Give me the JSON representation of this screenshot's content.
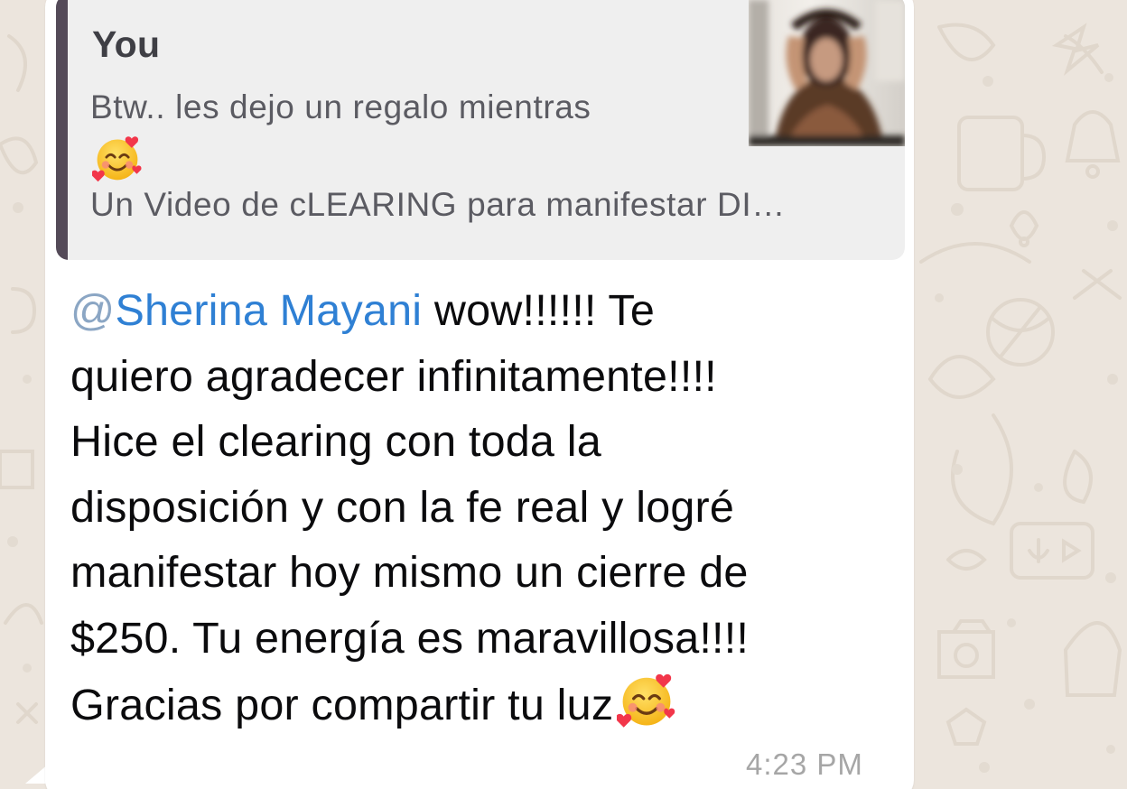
{
  "quoted_message": {
    "author": "You",
    "line1": "Btw.. les dejo un regalo mientras",
    "emoji": "smiling-face-with-hearts",
    "line2": "Un Video de cLEARING para manifestar DI…",
    "thumbnail": "video-thumbnail"
  },
  "message": {
    "mention_at": "@",
    "mention_name": "Sherina Mayani",
    "line1_rest": " wow!!!!!! Te",
    "line2": "quiero agradecer infinitamente!!!!",
    "line3": "Hice el clearing con toda la",
    "line4": "disposición y con la fe real y logré",
    "line5": "manifestar hoy mismo un cierre de",
    "line6": "$250. Tu energía es maravillosa!!!!",
    "line7": "Gracias por compartir tu luz",
    "emoji": "smiling-face-with-hearts",
    "time": "4:23 PM"
  },
  "colors": {
    "wallpaper": "#ece5dd",
    "bubble": "#ffffff",
    "quote_background": "#efefef",
    "quote_bar": "#544a58",
    "mention": "#2f80d4",
    "timestamp": "#a6a6a6"
  }
}
